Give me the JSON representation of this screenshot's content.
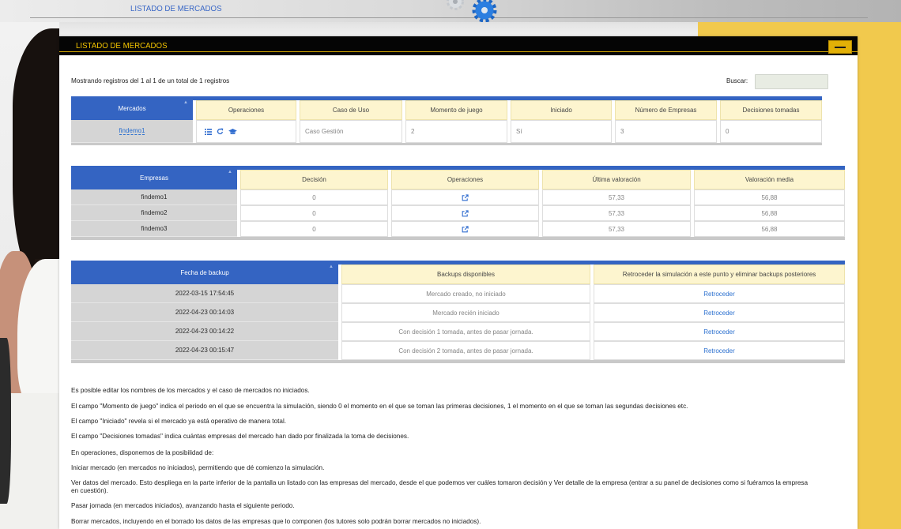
{
  "header": {
    "title": "LISTADO DE MERCADOS",
    "logo_icon": "gears-icon"
  },
  "panel": {
    "title": "LISTADO DE MERCADOS",
    "minimize_icon": "minimize-icon"
  },
  "records_info": "Mostrando registros del 1 al 1 de un total de 1 registros",
  "search": {
    "label": "Buscar:"
  },
  "markets_table": {
    "headers": [
      "Mercados",
      "Operaciones",
      "Caso de Uso",
      "Momento de juego",
      "Iniciado",
      "Número de Empresas",
      "Decisiones tomadas"
    ],
    "sort_icon": "sort-asc-icon",
    "rows": [
      {
        "mercado": "findemo1",
        "operaciones": [
          "list-icon",
          "refresh-icon",
          "graduation-cap-icon"
        ],
        "caso_de_uso": "Caso Gestión",
        "momento_de_juego": "2",
        "iniciado": "Sí",
        "numero_de_empresas": "3",
        "decisiones_tomadas": "0"
      }
    ]
  },
  "companies_table": {
    "headers": [
      "Empresas",
      "Decisión",
      "Operaciones",
      "Última valoración",
      "Valoración media"
    ],
    "sort_icon": "sort-asc-icon",
    "rows": [
      {
        "empresa": "findemo1",
        "decision": "0",
        "operaciones": [
          "external-link-icon"
        ],
        "ultima_valoracion": "57,33",
        "valoracion_media": "56,88"
      },
      {
        "empresa": "findemo2",
        "decision": "0",
        "operaciones": [
          "external-link-icon"
        ],
        "ultima_valoracion": "57,33",
        "valoracion_media": "56,88"
      },
      {
        "empresa": "findemo3",
        "decision": "0",
        "operaciones": [
          "external-link-icon"
        ],
        "ultima_valoracion": "57,33",
        "valoracion_media": "56,88"
      }
    ]
  },
  "backups_table": {
    "headers": [
      "Fecha de backup",
      "Backups disponibles",
      "Retroceder la simulación a este punto y eliminar backups posteriores"
    ],
    "sort_icon": "sort-asc-icon",
    "rows": [
      {
        "fecha": "2022-03-15 17:54:45",
        "descripcion": "Mercado creado, no iniciado",
        "accion": "Retroceder"
      },
      {
        "fecha": "2022-04-23 00:14:03",
        "descripcion": "Mercado recién iniciado",
        "accion": "Retroceder"
      },
      {
        "fecha": "2022-04-23 00:14:22",
        "descripcion": "Con decisión 1 tomada, antes de pasar jornada.",
        "accion": "Retroceder"
      },
      {
        "fecha": "2022-04-23 00:15:47",
        "descripcion": "Con decisión 2 tomada, antes de pasar jornada.",
        "accion": "Retroceder"
      }
    ]
  },
  "help": {
    "paragraphs": [
      "Es posible editar los nombres de los mercados y el caso de mercados no iniciados.",
      "El campo \"Momento de juego\" indica el periodo en el que se encuentra la simulación, siendo 0 el momento en el que se toman las primeras decisiones, 1 el momento en el que se toman las segundas decisiones etc.",
      "El campo \"Iniciado\" revela si el mercado ya está operativo de manera total.",
      "El campo \"Decisiones tomadas\" indica cuántas empresas del mercado han dado por finalizada la toma de decisiones.",
      "En operaciones, disponemos de la posibilidad de:",
      "Iniciar mercado (en mercados no iniciados), permitiendo que dé comienzo la simulación.",
      "Ver datos del mercado. Esto despliega en la parte inferior de la pantalla un listado con las empresas del mercado, desde el que podemos ver cuáles tomaron decisión y Ver detalle de la empresa (entrar a su panel de decisiones como si fuéramos la empresa en cuestión).",
      "Pasar jornada (en mercados iniciados), avanzando hasta el siguiente periodo.",
      "Borrar mercados, incluyendo en el borrado los datos de las empresas que lo componen (los tutores solo podrán borrar mercados no iniciados)."
    ]
  },
  "colors": {
    "table_header_blue": "#3464c2",
    "table_header_cream": "#fdf5cf",
    "panel_title_gold": "#f2c400",
    "link_blue": "#2a6fcf",
    "side_yellow": "#f1c94d"
  }
}
